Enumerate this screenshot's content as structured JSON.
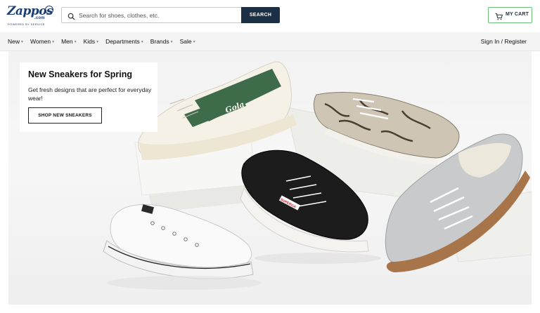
{
  "header": {
    "logo": {
      "wordmark": "Zappos",
      "dotcom": ".com",
      "tagline": "POWERED BY SERVICE"
    },
    "search": {
      "placeholder": "Search for shoes, clothes, etc.",
      "button_label": "SEARCH"
    },
    "cart": {
      "label": "MY CART"
    }
  },
  "nav": {
    "items": [
      {
        "label": "New"
      },
      {
        "label": "Women"
      },
      {
        "label": "Men"
      },
      {
        "label": "Kids"
      },
      {
        "label": "Departments"
      },
      {
        "label": "Brands"
      },
      {
        "label": "Sale"
      }
    ],
    "signin_label": "Sign In / Register"
  },
  "hero": {
    "title": "New Sneakers for Spring",
    "description": "Get fresh designs that are perfect for everyday wear!",
    "cta_label": "SHOP NEW SNEAKERS",
    "image_labels": {
      "gola_brand": "Gola",
      "superga_brand": "SUPERGA"
    }
  },
  "colors": {
    "brand_navy": "#1b3f73",
    "search_button": "#1b3044",
    "cart_border": "#6cbf7a",
    "nav_background": "#f4f4f4"
  },
  "icons": [
    "search-icon",
    "cart-icon",
    "chevron-down-icon"
  ]
}
